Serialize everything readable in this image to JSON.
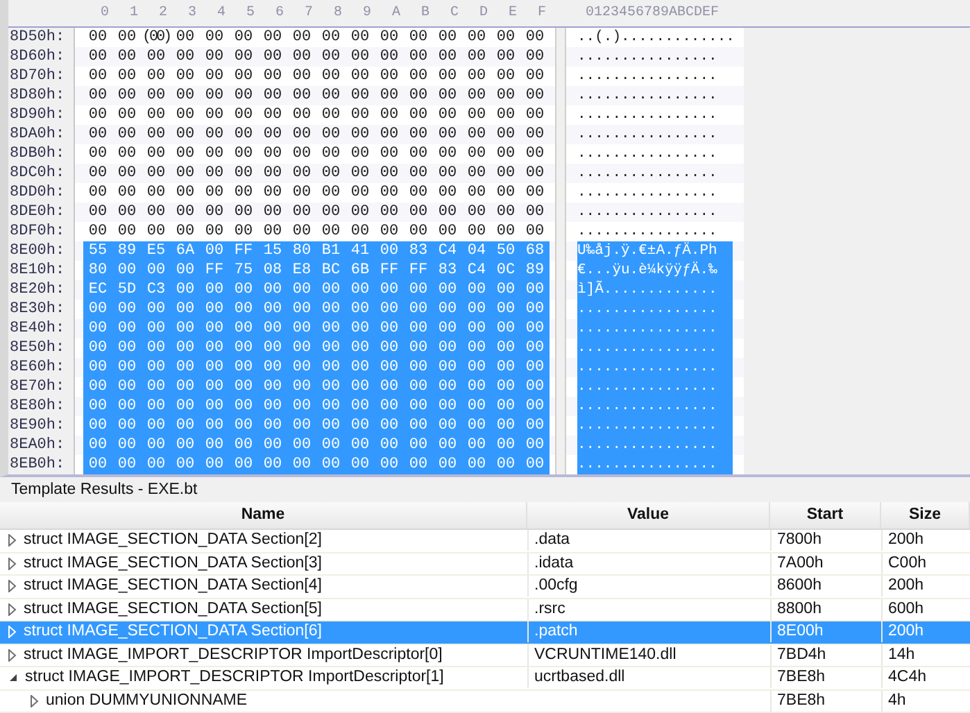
{
  "hex_view": {
    "column_headers": [
      "0",
      "1",
      "2",
      "3",
      "4",
      "5",
      "6",
      "7",
      "8",
      "9",
      "A",
      "B",
      "C",
      "D",
      "E",
      "F"
    ],
    "ascii_header": "0123456789ABCDEF",
    "rows": [
      {
        "address": "8D50h:",
        "bytes": [
          "00",
          "00",
          "(00)",
          "00",
          "00",
          "00",
          "00",
          "00",
          "00",
          "00",
          "00",
          "00",
          "00",
          "00",
          "00",
          "00"
        ],
        "ascii": "..(.).............",
        "selected": false
      },
      {
        "address": "8D60h:",
        "bytes": [
          "00",
          "00",
          "00",
          "00",
          "00",
          "00",
          "00",
          "00",
          "00",
          "00",
          "00",
          "00",
          "00",
          "00",
          "00",
          "00"
        ],
        "ascii": "................",
        "selected": false
      },
      {
        "address": "8D70h:",
        "bytes": [
          "00",
          "00",
          "00",
          "00",
          "00",
          "00",
          "00",
          "00",
          "00",
          "00",
          "00",
          "00",
          "00",
          "00",
          "00",
          "00"
        ],
        "ascii": "................",
        "selected": false
      },
      {
        "address": "8D80h:",
        "bytes": [
          "00",
          "00",
          "00",
          "00",
          "00",
          "00",
          "00",
          "00",
          "00",
          "00",
          "00",
          "00",
          "00",
          "00",
          "00",
          "00"
        ],
        "ascii": "................",
        "selected": false
      },
      {
        "address": "8D90h:",
        "bytes": [
          "00",
          "00",
          "00",
          "00",
          "00",
          "00",
          "00",
          "00",
          "00",
          "00",
          "00",
          "00",
          "00",
          "00",
          "00",
          "00"
        ],
        "ascii": "................",
        "selected": false
      },
      {
        "address": "8DA0h:",
        "bytes": [
          "00",
          "00",
          "00",
          "00",
          "00",
          "00",
          "00",
          "00",
          "00",
          "00",
          "00",
          "00",
          "00",
          "00",
          "00",
          "00"
        ],
        "ascii": "................",
        "selected": false
      },
      {
        "address": "8DB0h:",
        "bytes": [
          "00",
          "00",
          "00",
          "00",
          "00",
          "00",
          "00",
          "00",
          "00",
          "00",
          "00",
          "00",
          "00",
          "00",
          "00",
          "00"
        ],
        "ascii": "................",
        "selected": false
      },
      {
        "address": "8DC0h:",
        "bytes": [
          "00",
          "00",
          "00",
          "00",
          "00",
          "00",
          "00",
          "00",
          "00",
          "00",
          "00",
          "00",
          "00",
          "00",
          "00",
          "00"
        ],
        "ascii": "................",
        "selected": false
      },
      {
        "address": "8DD0h:",
        "bytes": [
          "00",
          "00",
          "00",
          "00",
          "00",
          "00",
          "00",
          "00",
          "00",
          "00",
          "00",
          "00",
          "00",
          "00",
          "00",
          "00"
        ],
        "ascii": "................",
        "selected": false
      },
      {
        "address": "8DE0h:",
        "bytes": [
          "00",
          "00",
          "00",
          "00",
          "00",
          "00",
          "00",
          "00",
          "00",
          "00",
          "00",
          "00",
          "00",
          "00",
          "00",
          "00"
        ],
        "ascii": "................",
        "selected": false
      },
      {
        "address": "8DF0h:",
        "bytes": [
          "00",
          "00",
          "00",
          "00",
          "00",
          "00",
          "00",
          "00",
          "00",
          "00",
          "00",
          "00",
          "00",
          "00",
          "00",
          "00"
        ],
        "ascii": "................",
        "selected": false
      },
      {
        "address": "8E00h:",
        "bytes": [
          "55",
          "89",
          "E5",
          "6A",
          "00",
          "FF",
          "15",
          "80",
          "B1",
          "41",
          "00",
          "83",
          "C4",
          "04",
          "50",
          "68"
        ],
        "ascii": "U‰åj.ÿ.€±A.ƒÄ.Ph",
        "selected": true
      },
      {
        "address": "8E10h:",
        "bytes": [
          "80",
          "00",
          "00",
          "00",
          "FF",
          "75",
          "08",
          "E8",
          "BC",
          "6B",
          "FF",
          "FF",
          "83",
          "C4",
          "0C",
          "89"
        ],
        "ascii": "€...ÿu.è¼kÿÿƒÄ.‰",
        "selected": true
      },
      {
        "address": "8E20h:",
        "bytes": [
          "EC",
          "5D",
          "C3",
          "00",
          "00",
          "00",
          "00",
          "00",
          "00",
          "00",
          "00",
          "00",
          "00",
          "00",
          "00",
          "00"
        ],
        "ascii": "ì]Ã.............",
        "selected": true
      },
      {
        "address": "8E30h:",
        "bytes": [
          "00",
          "00",
          "00",
          "00",
          "00",
          "00",
          "00",
          "00",
          "00",
          "00",
          "00",
          "00",
          "00",
          "00",
          "00",
          "00"
        ],
        "ascii": "................",
        "selected": true
      },
      {
        "address": "8E40h:",
        "bytes": [
          "00",
          "00",
          "00",
          "00",
          "00",
          "00",
          "00",
          "00",
          "00",
          "00",
          "00",
          "00",
          "00",
          "00",
          "00",
          "00"
        ],
        "ascii": "................",
        "selected": true
      },
      {
        "address": "8E50h:",
        "bytes": [
          "00",
          "00",
          "00",
          "00",
          "00",
          "00",
          "00",
          "00",
          "00",
          "00",
          "00",
          "00",
          "00",
          "00",
          "00",
          "00"
        ],
        "ascii": "................",
        "selected": true
      },
      {
        "address": "8E60h:",
        "bytes": [
          "00",
          "00",
          "00",
          "00",
          "00",
          "00",
          "00",
          "00",
          "00",
          "00",
          "00",
          "00",
          "00",
          "00",
          "00",
          "00"
        ],
        "ascii": "................",
        "selected": true
      },
      {
        "address": "8E70h:",
        "bytes": [
          "00",
          "00",
          "00",
          "00",
          "00",
          "00",
          "00",
          "00",
          "00",
          "00",
          "00",
          "00",
          "00",
          "00",
          "00",
          "00"
        ],
        "ascii": "................",
        "selected": true
      },
      {
        "address": "8E80h:",
        "bytes": [
          "00",
          "00",
          "00",
          "00",
          "00",
          "00",
          "00",
          "00",
          "00",
          "00",
          "00",
          "00",
          "00",
          "00",
          "00",
          "00"
        ],
        "ascii": "................",
        "selected": true
      },
      {
        "address": "8E90h:",
        "bytes": [
          "00",
          "00",
          "00",
          "00",
          "00",
          "00",
          "00",
          "00",
          "00",
          "00",
          "00",
          "00",
          "00",
          "00",
          "00",
          "00"
        ],
        "ascii": "................",
        "selected": true
      },
      {
        "address": "8EA0h:",
        "bytes": [
          "00",
          "00",
          "00",
          "00",
          "00",
          "00",
          "00",
          "00",
          "00",
          "00",
          "00",
          "00",
          "00",
          "00",
          "00",
          "00"
        ],
        "ascii": "................",
        "selected": true
      },
      {
        "address": "8EB0h:",
        "bytes": [
          "00",
          "00",
          "00",
          "00",
          "00",
          "00",
          "00",
          "00",
          "00",
          "00",
          "00",
          "00",
          "00",
          "00",
          "00",
          "00"
        ],
        "ascii": "................",
        "selected": true
      }
    ]
  },
  "template_results": {
    "title": "Template Results - EXE.bt",
    "columns": [
      "Name",
      "Value",
      "Start",
      "Size"
    ],
    "rows": [
      {
        "name": "struct IMAGE_SECTION_DATA Section[2]",
        "value": ".data",
        "start": "7800h",
        "size": "200h",
        "expanded": false,
        "selected": false
      },
      {
        "name": "struct IMAGE_SECTION_DATA Section[3]",
        "value": ".idata",
        "start": "7A00h",
        "size": "C00h",
        "expanded": false,
        "selected": false
      },
      {
        "name": "struct IMAGE_SECTION_DATA Section[4]",
        "value": ".00cfg",
        "start": "8600h",
        "size": "200h",
        "expanded": false,
        "selected": false
      },
      {
        "name": "struct IMAGE_SECTION_DATA Section[5]",
        "value": ".rsrc",
        "start": "8800h",
        "size": "600h",
        "expanded": false,
        "selected": false
      },
      {
        "name": "struct IMAGE_SECTION_DATA Section[6]",
        "value": ".patch",
        "start": "8E00h",
        "size": "200h",
        "expanded": false,
        "selected": true
      },
      {
        "name": "struct IMAGE_IMPORT_DESCRIPTOR ImportDescriptor[0]",
        "value": "VCRUNTIME140.dll",
        "start": "7BD4h",
        "size": "14h",
        "expanded": false,
        "selected": false
      },
      {
        "name": "struct IMAGE_IMPORT_DESCRIPTOR ImportDescriptor[1]",
        "value": "ucrtbased.dll",
        "start": "7BE8h",
        "size": "4C4h",
        "expanded": true,
        "selected": false,
        "children": [
          {
            "name": "union DUMMYUNIONNAME",
            "start": "7BE8h",
            "size": "4h",
            "expanded": false,
            "selected": false
          }
        ]
      }
    ]
  }
}
